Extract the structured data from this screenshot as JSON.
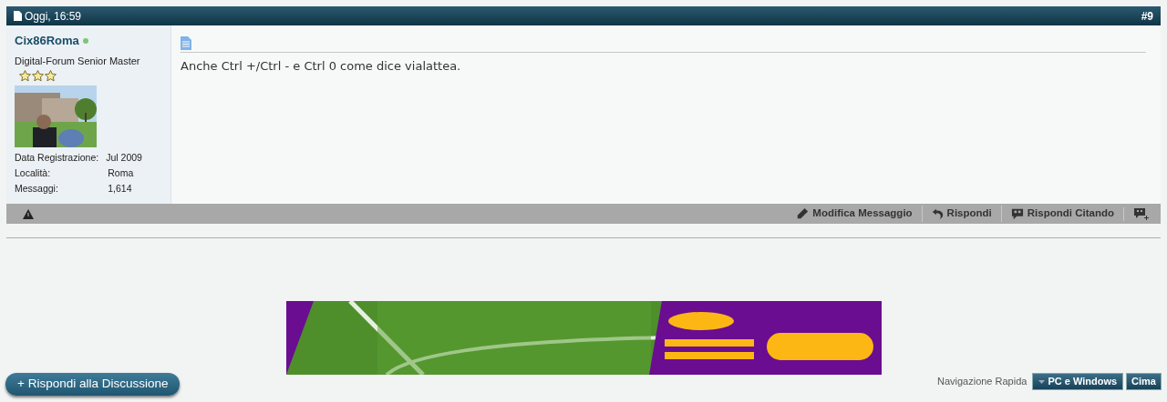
{
  "post": {
    "date": "Oggi, 16:59",
    "number": "#9",
    "user": {
      "name": "Cix86Roma",
      "online": true,
      "rank": "Digital-Forum Senior Master",
      "stars": 3,
      "details": [
        {
          "label": "Data Registrazione:",
          "value": "Jul 2009"
        },
        {
          "label": "Località:",
          "value": "Roma"
        },
        {
          "label": "Messaggi:",
          "value": "1,614"
        }
      ]
    },
    "message": "Anche Ctrl +/Ctrl - e Ctrl 0 come dice vialattea.",
    "actions": [
      {
        "kind": "edit",
        "label": "Modifica Messaggio"
      },
      {
        "kind": "reply",
        "label": "Rispondi"
      },
      {
        "kind": "quote",
        "label": "Rispondi Citando"
      },
      {
        "kind": "multiquote"
      }
    ]
  },
  "reply_button": "+ Rispondi alla Discussione",
  "quick_nav": {
    "label": "Navigazione Rapida",
    "forum": "PC e Windows",
    "top": "Cima"
  }
}
